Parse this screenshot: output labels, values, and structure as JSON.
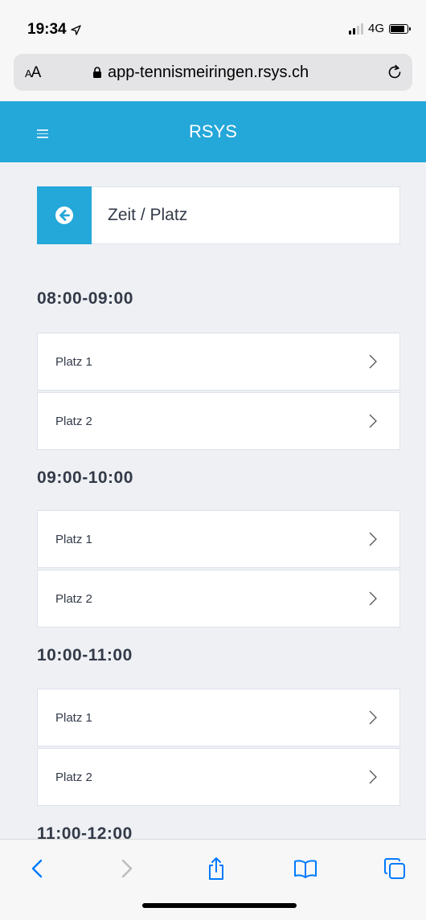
{
  "status_bar": {
    "time": "19:34",
    "network": "4G"
  },
  "browser": {
    "aa_label_small": "A",
    "aa_label_large": "A",
    "url": "app-tennismeiringen.rsys.ch"
  },
  "header": {
    "title": "RSYS"
  },
  "page": {
    "title": "Zeit / Platz"
  },
  "slots": [
    {
      "time": "08:00-09:00",
      "courts": [
        "Platz 1",
        "Platz 2"
      ]
    },
    {
      "time": "09:00-10:00",
      "courts": [
        "Platz 1",
        "Platz 2"
      ]
    },
    {
      "time": "10:00-11:00",
      "courts": [
        "Platz 1",
        "Platz 2"
      ]
    },
    {
      "time": "11:00-12:00",
      "courts": []
    }
  ],
  "colors": {
    "accent": "#24a7d9",
    "background": "#eef0f4",
    "text": "#333a48",
    "ios_blue": "#007aff"
  },
  "icons": {
    "location": "location-arrow-icon",
    "lock": "lock-icon",
    "reload": "reload-icon",
    "menu": "hamburger-icon",
    "back": "arrow-left-circle-icon",
    "chevron": "chevron-right-icon",
    "toolbar": [
      "chevron-left-icon",
      "chevron-right-icon",
      "share-icon",
      "book-icon",
      "tabs-icon"
    ]
  }
}
